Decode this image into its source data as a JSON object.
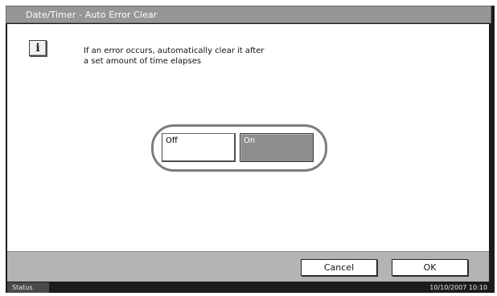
{
  "window": {
    "title": "Date/Timer - Auto Error Clear"
  },
  "message": {
    "icon": "info-icon",
    "line1": "If an error occurs, automatically clear it after",
    "line2": "a set amount of time elapses"
  },
  "options": {
    "off_label": "Off",
    "on_label": "On",
    "selected": "On"
  },
  "footer": {
    "cancel_label": "Cancel",
    "ok_label": "OK"
  },
  "status_bar": {
    "status_label": "Status",
    "datetime": "10/10/2007  10:10"
  },
  "colors": {
    "title_bar": "#969696",
    "selected_option": "#8e8e8e",
    "frame": "#1c1c1c"
  }
}
